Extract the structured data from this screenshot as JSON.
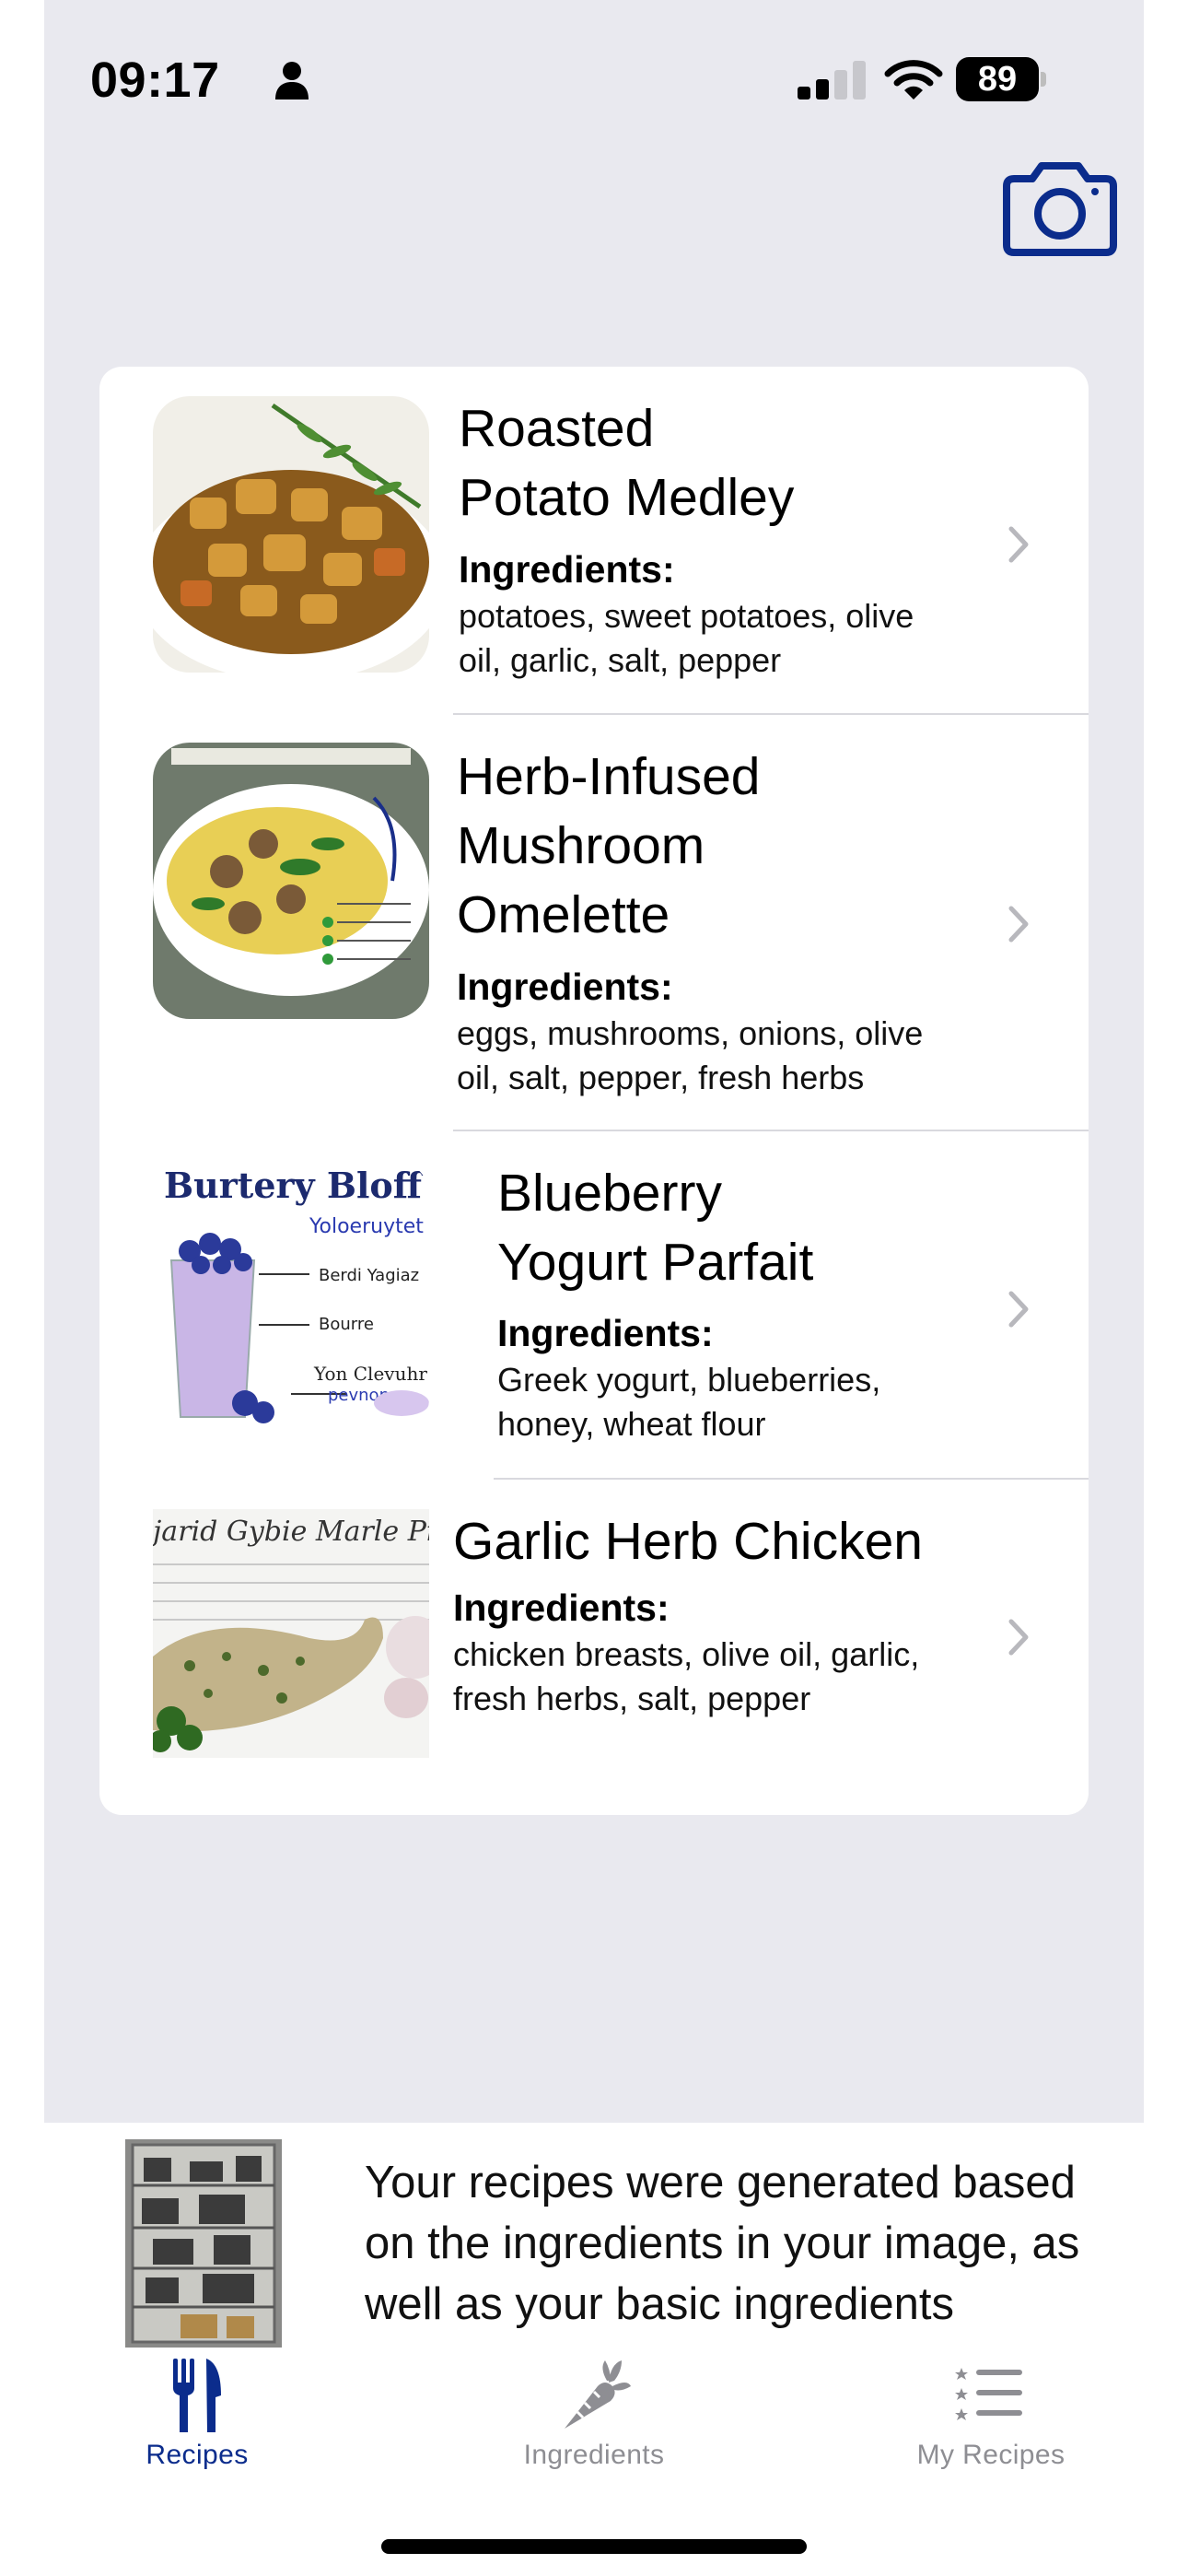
{
  "status_bar": {
    "time": "09:17",
    "battery": "89"
  },
  "camera": {
    "icon": "camera-icon",
    "color": "#0b2c8c"
  },
  "recipes": [
    {
      "title_lines": [
        "Roasted",
        "Potato Medley"
      ],
      "ingredients_label": "Ingredients:",
      "ingredients_lines": [
        "potatoes, sweet potatoes, olive",
        "oil, garlic, salt, pepper"
      ]
    },
    {
      "title_lines": [
        "Herb-Infused",
        "Mushroom",
        "Omelette"
      ],
      "ingredients_label": "Ingredients:",
      "ingredients_lines": [
        "eggs, mushrooms, onions, olive",
        "oil, salt, pepper, fresh herbs"
      ]
    },
    {
      "title_lines": [
        "Blueberry",
        "Yogurt Parfait"
      ],
      "ingredients_label": "Ingredients:",
      "ingredients_lines": [
        "Greek yogurt, blueberries,",
        "honey, wheat flour"
      ]
    },
    {
      "title_lines": [
        "Garlic Herb Chicken"
      ],
      "ingredients_label": "Ingredients:",
      "ingredients_lines": [
        "chicken breasts, olive oil, garlic,",
        "fresh herbs, salt, pepper"
      ]
    }
  ],
  "info": {
    "lines": [
      "Your recipes were generated based",
      "on the ingredients in your image, as",
      "well as your basic ingredients"
    ]
  },
  "tabs": [
    {
      "label": "Recipes",
      "icon": "fork-knife-icon",
      "active": true
    },
    {
      "label": "Ingredients",
      "icon": "carrot-icon",
      "active": false
    },
    {
      "label": "My Recipes",
      "icon": "list-icon",
      "active": false
    }
  ],
  "colors": {
    "accent": "#0b2c8c",
    "inactive": "#8e8e93",
    "background": "#e9e9ef"
  }
}
